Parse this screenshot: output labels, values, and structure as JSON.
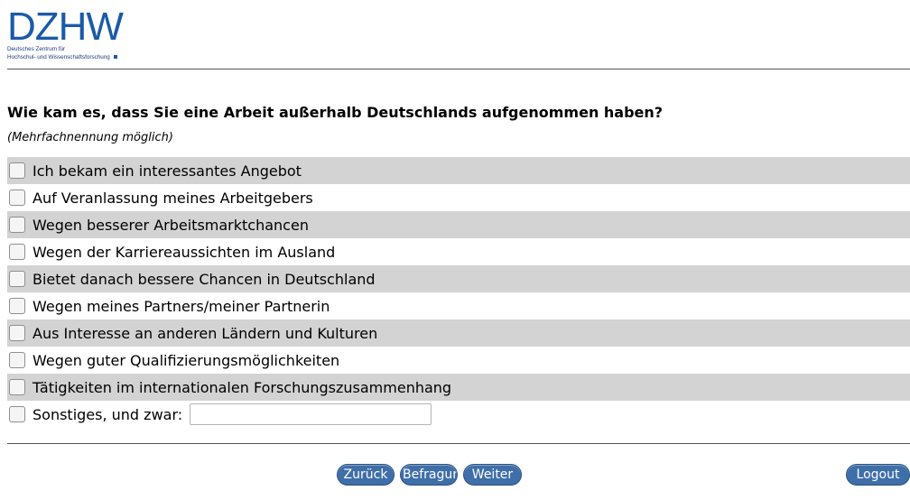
{
  "logo": {
    "mark": "DZHW",
    "subline_1": "Deutsches Zentrum für",
    "subline_2": "Hochschul- und Wissenschaftsforschung"
  },
  "question": {
    "text": "Wie kam es, dass Sie eine Arbeit außerhalb Deutschlands aufgenommen haben?",
    "hint": "(Mehrfachnennung möglich)"
  },
  "options": [
    {
      "label": "Ich bekam ein interessantes Angebot",
      "checked": false
    },
    {
      "label": "Auf Veranlassung meines Arbeitgebers",
      "checked": false
    },
    {
      "label": "Wegen besserer Arbeitsmarktchancen",
      "checked": false
    },
    {
      "label": "Wegen der Karriereaussichten im Ausland",
      "checked": false
    },
    {
      "label": "Bietet danach bessere Chancen in Deutschland",
      "checked": false
    },
    {
      "label": "Wegen meines Partners/meiner Partnerin",
      "checked": false
    },
    {
      "label": "Aus Interesse an anderen Ländern und Kulturen",
      "checked": false
    },
    {
      "label": "Wegen guter Qualifizierungsmöglichkeiten",
      "checked": false
    },
    {
      "label": "Tätigkeiten im internationalen Forschungszusammenhang",
      "checked": false
    },
    {
      "label": "Sonstiges, und zwar:",
      "checked": false,
      "input_value": ""
    }
  ],
  "nav": {
    "back_label": "Zurück",
    "survey_label": "Befragung",
    "next_label": "Weiter",
    "logout_label": "Logout"
  },
  "colors": {
    "button_bg": "#3f6fa8",
    "row_shade": "#d3d3d3",
    "logo_blue": "#1a5aa8"
  }
}
